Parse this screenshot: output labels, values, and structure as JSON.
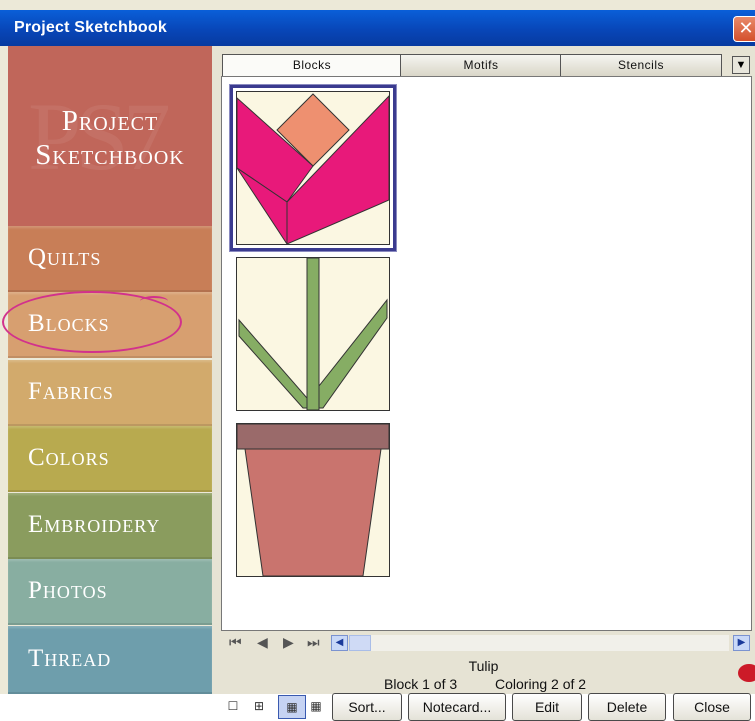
{
  "window": {
    "title": "Project Sketchbook",
    "close_glyph": "✕"
  },
  "sidebar": {
    "header_title": "Project Sketchbook",
    "header_watermark": "PS7",
    "items": [
      {
        "label": "Quilts",
        "color": "#c87e57"
      },
      {
        "label": "Blocks",
        "color": "#d79f70"
      },
      {
        "label": "Fabrics",
        "color": "#d2aa6c"
      },
      {
        "label": "Colors",
        "color": "#b8aa4f"
      },
      {
        "label": "Embroidery",
        "color": "#8a9c5e"
      },
      {
        "label": "Photos",
        "color": "#88aea1"
      },
      {
        "label": "Thread",
        "color": "#6e9eac"
      }
    ],
    "header_color": "#c0665a",
    "highlight_color": "#d2318c"
  },
  "tabs": [
    {
      "label": "Blocks",
      "active": true
    },
    {
      "label": "Motifs",
      "active": false
    },
    {
      "label": "Stencils",
      "active": false
    }
  ],
  "tabs_menu_icon": "dropdown-icon",
  "blocks": [
    {
      "name": "Tulip",
      "selected": true
    },
    {
      "name": "Leaves",
      "selected": false
    },
    {
      "name": "Flower Pot",
      "selected": false
    }
  ],
  "colors": {
    "background_fabric": "#fbf7e2",
    "petal_pink": "#e8197a",
    "petal_orange": "#ee9070",
    "stem_green": "#86ad64",
    "pot": "#c9746e",
    "pot_rim": "#9a6a6a",
    "selection": "#3b3b8f"
  },
  "nav": {
    "first": "first-icon",
    "prev": "prev-icon",
    "next": "next-icon",
    "last": "last-icon"
  },
  "info": {
    "block_name": "Tulip",
    "block_position": "Block 1 of 3",
    "coloring_position": "Coloring 2 of 2"
  },
  "view_modes": [
    {
      "icon": "large-thumbnail-icon",
      "glyph": "☐"
    },
    {
      "icon": "medium-thumbnail-icon",
      "glyph": "⊞"
    },
    {
      "icon": "small-thumbnail-icon",
      "glyph": "▦",
      "active": true
    },
    {
      "icon": "list-thumbnail-icon",
      "glyph": "▦"
    }
  ],
  "buttons": {
    "sort": "Sort...",
    "notecard": "Notecard...",
    "edit": "Edit",
    "delete": "Delete",
    "close": "Close"
  }
}
